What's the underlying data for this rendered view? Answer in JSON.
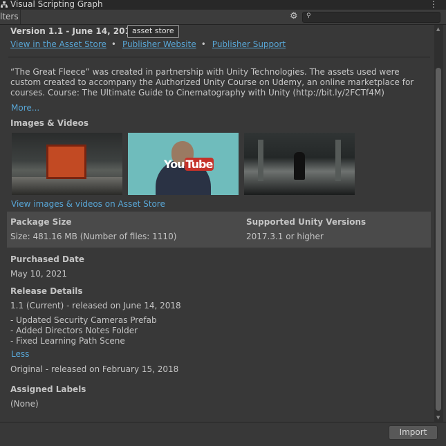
{
  "window": {
    "title": "Visual Scripting Graph",
    "menu_icon": "kebab-icon"
  },
  "toolbar": {
    "filters_label": "lters",
    "search_placeholder": "",
    "search_icon": "search-icon",
    "gear_icon": "gear-icon"
  },
  "package": {
    "version": "Version 1.1 - June 14, 2018",
    "badge": "asset store",
    "links": [
      "View in the Asset Store",
      "Publisher Website",
      "Publisher Support"
    ],
    "description": "“The Great Fleece” was created in partnership with Unity Technologies. The assets used were custom created to accompany the Authorized Unity Course on Udemy, an online marketplace for courses. Course:  The Ultimate Guide to Cinematography with Unity (http://bit.ly/2FCTf4M)",
    "more_label": "More...",
    "images_title": "Images & Videos",
    "view_media_label": "View images & videos on Asset Store",
    "size_title": "Package Size",
    "size_value": "Size: 481.16 MB (Number of files: 1110)",
    "versions_title": "Supported Unity Versions",
    "versions_value": "2017.3.1 or higher",
    "purchased_title": "Purchased Date",
    "purchased_value": "May 10, 2021",
    "release_title": "Release Details",
    "current_release": "1.1 (Current) - released on June 14, 2018",
    "release_notes": [
      "- Updated Security Cameras Prefab",
      "- Added Directors Notes Folder",
      "- Fixed Learning Path Scene"
    ],
    "less_label": "Less",
    "original_release": "Original - released on February 15, 2018",
    "labels_title": "Assigned Labels",
    "labels_value": "(None)"
  },
  "footer": {
    "import_label": "Import"
  }
}
